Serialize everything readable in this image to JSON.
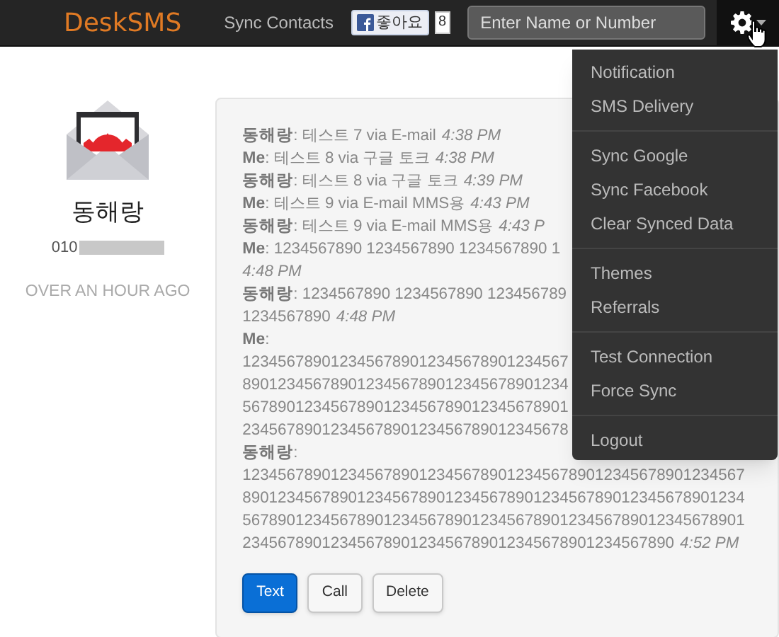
{
  "navbar": {
    "brand": "DeskSMS",
    "sync_link": "Sync Contacts",
    "like_button": {
      "label": "좋아요",
      "count": "8"
    },
    "search": {
      "placeholder": "Enter Name or Number"
    }
  },
  "contact": {
    "name": "동해랑",
    "number": "010",
    "last_seen": "OVER AN HOUR AGO"
  },
  "messages": [
    {
      "sender": "동해랑",
      "text": ": 테스트 7 via E-mail",
      "time": "4:38 PM"
    },
    {
      "sender": "Me",
      "text": ": 테스트 8 via 구글 토크",
      "time": "4:38 PM"
    },
    {
      "sender": "동해랑",
      "text": ": 테스트 8 via 구글 토크",
      "time": "4:39 PM"
    },
    {
      "sender": "Me",
      "text": ": 테스트 9 via E-mail MMS용",
      "time": "4:43 PM"
    },
    {
      "sender": "동해랑",
      "text": ": 테스트 9 via E-mail MMS용",
      "time": "4:43 P"
    },
    {
      "sender": "Me",
      "text": ": 1234567890 1234567890 1234567890 1"
    },
    {
      "time": "4:48 PM"
    },
    {
      "sender": "동해랑",
      "text": ": 1234567890 1234567890 123456789"
    },
    {
      "text": "1234567890",
      "time": "4:48 PM"
    },
    {
      "sender": "Me",
      "text": ":"
    },
    {
      "text": "1234567890123456789012345678901234567"
    },
    {
      "text": "8901234567890123456789012345678901234"
    },
    {
      "text": "5678901234567890123456789012345678901"
    },
    {
      "text": "2345678901234567890123456789012345678"
    },
    {
      "sender": "동해랑",
      "text": ":"
    },
    {
      "text": "123456789012345678901234567890123456789012345678901234567"
    },
    {
      "text": "890123456789012345678901234567890123456789012345678901234"
    },
    {
      "text": "567890123456789012345678901234567890123456789012345678901"
    },
    {
      "text": "2345678901234567890123456789012345678901234567890",
      "time": "4:52 PM"
    }
  ],
  "actions": [
    {
      "label": "Text",
      "kind": "primary"
    },
    {
      "label": "Call",
      "kind": "default"
    },
    {
      "label": "Delete",
      "kind": "default"
    }
  ],
  "menu": {
    "groups": [
      [
        "Notification",
        "SMS Delivery"
      ],
      [
        "Sync Google",
        "Sync Facebook",
        "Clear Synced Data"
      ],
      [
        "Themes",
        "Referrals"
      ],
      [
        "Test Connection",
        "Force Sync"
      ],
      [
        "Logout"
      ]
    ]
  }
}
